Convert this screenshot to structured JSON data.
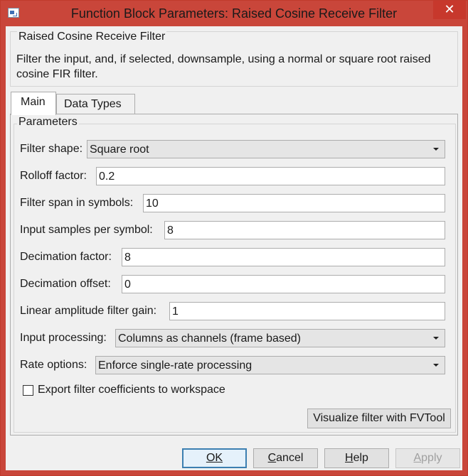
{
  "window": {
    "title": "Function Block Parameters: Raised Cosine Receive Filter",
    "close_glyph": "✕"
  },
  "description": {
    "group_title": "Raised Cosine Receive Filter",
    "text": "Filter the input, and, if selected, downsample, using a normal or square root raised cosine FIR filter."
  },
  "tabs": [
    {
      "label": "Main",
      "selected": true
    },
    {
      "label": "Data Types",
      "selected": false
    }
  ],
  "parameters": {
    "group_title": "Parameters",
    "filter_shape": {
      "label": "Filter shape:",
      "value": "Square root"
    },
    "rolloff_factor": {
      "label": "Rolloff factor:",
      "value": "0.2"
    },
    "filter_span": {
      "label": "Filter span in symbols:",
      "value": "10"
    },
    "input_samples_per_symbol": {
      "label": "Input samples per symbol:",
      "value": "8"
    },
    "decimation_factor": {
      "label": "Decimation factor:",
      "value": "8"
    },
    "decimation_offset": {
      "label": "Decimation offset:",
      "value": "0"
    },
    "linear_amplitude_gain": {
      "label": "Linear amplitude filter gain:",
      "value": "1"
    },
    "input_processing": {
      "label": "Input processing:",
      "value": "Columns as channels (frame based)"
    },
    "rate_options": {
      "label": "Rate options:",
      "value": "Enforce single-rate processing"
    },
    "export_coefficients": {
      "label": "Export filter coefficients to workspace",
      "checked": false
    },
    "visualize_button": "Visualize filter with FVTool"
  },
  "buttons": {
    "ok": {
      "label": "OK",
      "mnemonic": "O"
    },
    "cancel": {
      "label": "Cancel",
      "mnemonic": "C"
    },
    "help": {
      "label": "Help",
      "mnemonic": "H"
    },
    "apply": {
      "label": "Apply",
      "mnemonic": "A",
      "enabled": false
    }
  },
  "colors": {
    "titlebar": "#c9463a",
    "close_button": "#c7382c",
    "dialog_background": "#f0f0f0",
    "default_button_border": "#3c7fb1"
  }
}
